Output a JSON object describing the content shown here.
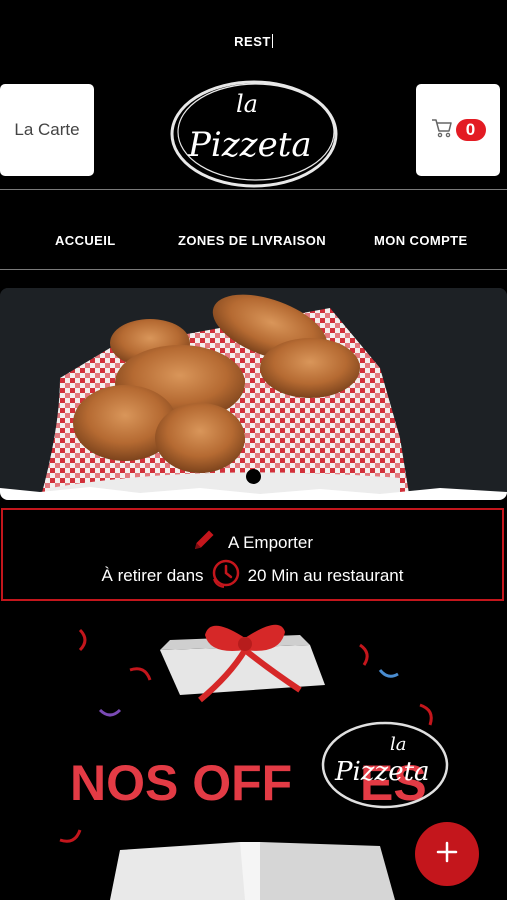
{
  "header": {
    "status_title": "REST",
    "menu_label": "La Carte",
    "logo_text_top": "la",
    "logo_text_main": "Pizzeta",
    "cart_count": "0"
  },
  "nav": {
    "items": [
      "ACCUEIL",
      "ZONES DE LIVRAISON",
      "MON COMPTE"
    ]
  },
  "order": {
    "mode": "A Emporter",
    "pickup_prefix": "À retirer dans",
    "pickup_time": "20 Min au restaurant"
  },
  "promo": {
    "title_part1": "NOS OFF",
    "title_part2": "ES",
    "logo_text_top": "la",
    "logo_text_main": "Pizzeta"
  },
  "colors": {
    "accent": "#c4161c",
    "background": "#000000"
  },
  "icons": {
    "cart": "cart-icon",
    "pencil": "pencil-icon",
    "clock": "clock-icon",
    "add": "plus-icon"
  }
}
